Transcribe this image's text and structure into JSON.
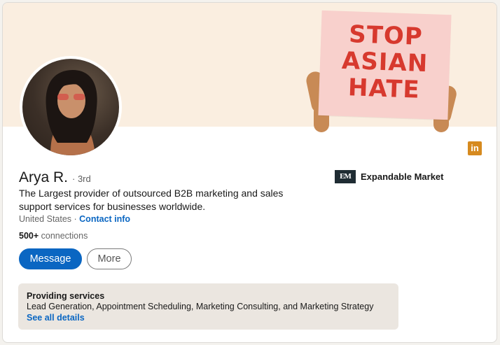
{
  "banner": {
    "sign_lines": [
      "STOP",
      "ASIAN",
      "HATE"
    ],
    "background_color": "#faeee0",
    "sign_color": "#f8d0cc",
    "sign_text_color": "#d7392e"
  },
  "profile": {
    "name": "Arya R.",
    "degree": "· 3rd",
    "headline": "The Largest provider of outsourced B2B marketing and sales support services for businesses worldwide.",
    "location": "United States",
    "separator": " · ",
    "contact_info_label": "Contact info",
    "connections_count": "500+",
    "connections_label": " connections"
  },
  "actions": {
    "message_label": "Message",
    "more_label": "More"
  },
  "company": {
    "logo_text": "EM",
    "name": "Expandable Market"
  },
  "brand_icon": {
    "text": "in",
    "color": "#d68a1f"
  },
  "services": {
    "title": "Providing services",
    "list": "Lead Generation, Appointment Scheduling, Marketing Consulting, and Marketing Strategy",
    "link_label": "See all details"
  },
  "colors": {
    "accent": "#0a66c2"
  }
}
